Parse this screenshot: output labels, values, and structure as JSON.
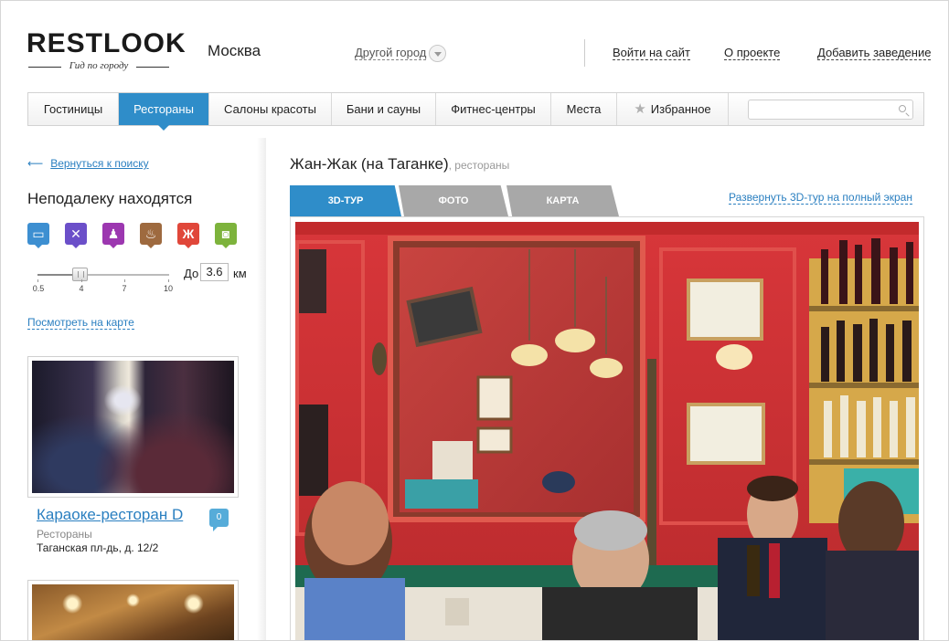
{
  "header": {
    "logo": "RESTLOOK",
    "logo_tagline": "Гид по городу",
    "city": "Москва",
    "other_city": "Другой город",
    "login": "Войти на сайт",
    "about": "О проекте",
    "add_place": "Добавить заведение"
  },
  "nav": {
    "items": [
      "Гостиницы",
      "Рестораны",
      "Салоны красоты",
      "Бани и сауны",
      "Фитнес-центры",
      "Места",
      "Избранное"
    ],
    "active": "Рестораны",
    "search_value": ""
  },
  "sidebar": {
    "back": "Вернуться к поиску",
    "nearby_title": "Неподалеку находятся",
    "categories": [
      {
        "name": "hotels",
        "color": "#3d8fd1"
      },
      {
        "name": "restaurants",
        "color": "#6b4fc9"
      },
      {
        "name": "beauty",
        "color": "#9c37b0"
      },
      {
        "name": "baths",
        "color": "#9e6a3f"
      },
      {
        "name": "fitness",
        "color": "#e0473a"
      },
      {
        "name": "places",
        "color": "#7db33c"
      }
    ],
    "slider": {
      "ticks": [
        "0.5",
        "4",
        "7",
        "10"
      ],
      "value": 3.6
    },
    "distance_prefix": "До",
    "distance_value": "3.6",
    "distance_unit": "км",
    "map_link": "Посмотреть на карте",
    "card": {
      "title": "Караоке-ресторан D",
      "type": "Рестораны",
      "address": "Таганская пл-дь, д. 12/2",
      "comments": "0"
    }
  },
  "main": {
    "title": "Жан-Жак (на Таганке)",
    "subtitle": ", рестораны",
    "tabs": [
      "3D-ТУР",
      "ФОТО",
      "КАРТА"
    ],
    "active_tab": "3D-ТУР",
    "expand_link": "Развернуть 3D-тур на полный экран"
  }
}
